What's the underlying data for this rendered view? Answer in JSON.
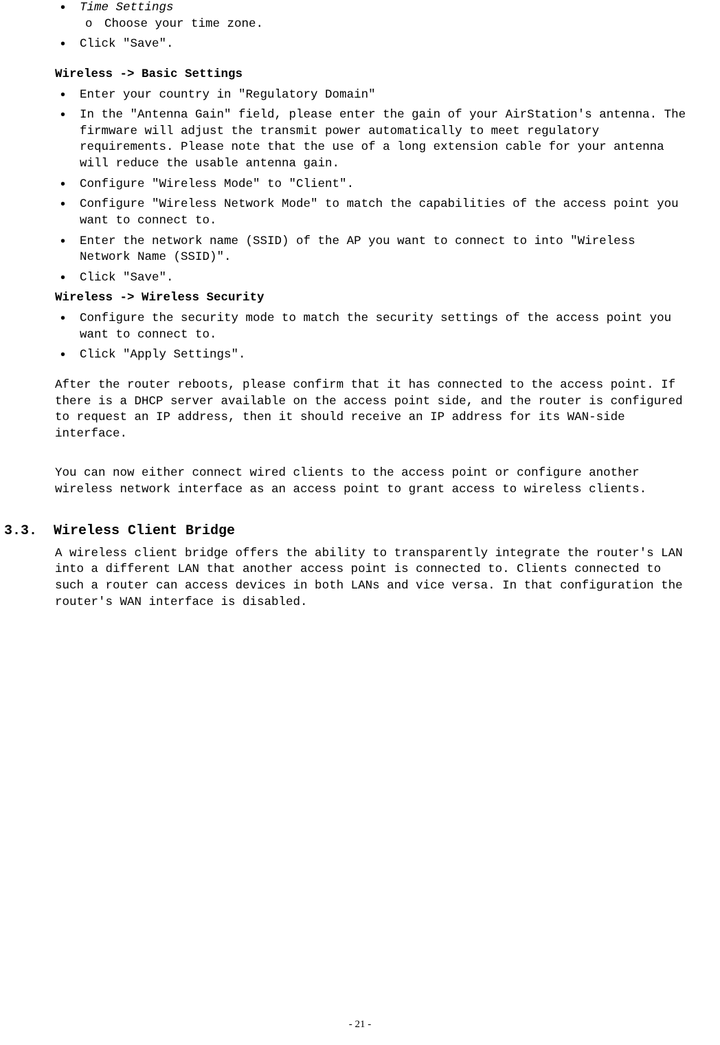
{
  "list1": {
    "item1": "Time Settings",
    "sub1": "Choose your time zone.",
    "item2": "Click \"Save\"."
  },
  "h1": "Wireless -> Basic Settings",
  "list2": {
    "i1": "Enter your country in \"Regulatory Domain\"",
    "i2": "In the \"Antenna Gain\" field, please enter the gain of your AirStation's antenna. The firmware will adjust the transmit power automatically to meet regulatory requirements. Please note that the use of a long extension cable for your antenna will reduce the usable antenna gain.",
    "i3": "Configure \"Wireless Mode\" to \"Client\".",
    "i4": "Configure \"Wireless Network Mode\" to match the capabilities of the access point you want to connect to.",
    "i5": "Enter the network name (SSID) of the AP you want to connect to into \"Wireless Network Name (SSID)\".",
    "i6": "Click \"Save\"."
  },
  "h2": "Wireless -> Wireless Security",
  "list3": {
    "i1": "Configure the security mode to match the security settings of the access point you want to connect to.",
    "i2": "Click \"Apply Settings\"."
  },
  "para1": "After the router reboots, please confirm that it has connected to the access point. If there is a DHCP server available on the access point side, and the router is configured to request an IP address, then it should receive an IP address for its WAN-side interface.",
  "para2": "You can now either connect wired clients to the access point or configure another wireless network interface as an access point to grant access to wireless clients.",
  "section": {
    "number": "3.3.",
    "title": "Wireless Client Bridge",
    "body": "A wireless client bridge offers the ability to transparently integrate the router's LAN into a different LAN that another access point is connected to. Clients connected to such a router can access devices in both LANs and vice versa. In that configuration the router's WAN interface is disabled."
  },
  "footer": "- 21 -"
}
